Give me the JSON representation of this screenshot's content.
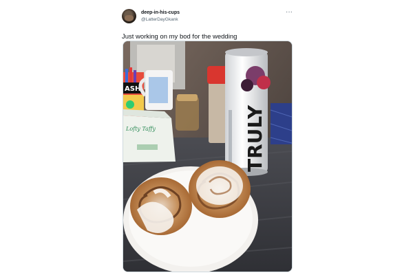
{
  "tweet": {
    "display_name": "deep-in-his-cups",
    "handle": "@LatterDayGkank",
    "more_icon": "more-horizontal-icon",
    "text": "Just working on my bod for the wedding",
    "media": {
      "can_brand": "TRULY",
      "box_label": "Lofty Taffy",
      "mug_text": "ASH"
    }
  }
}
